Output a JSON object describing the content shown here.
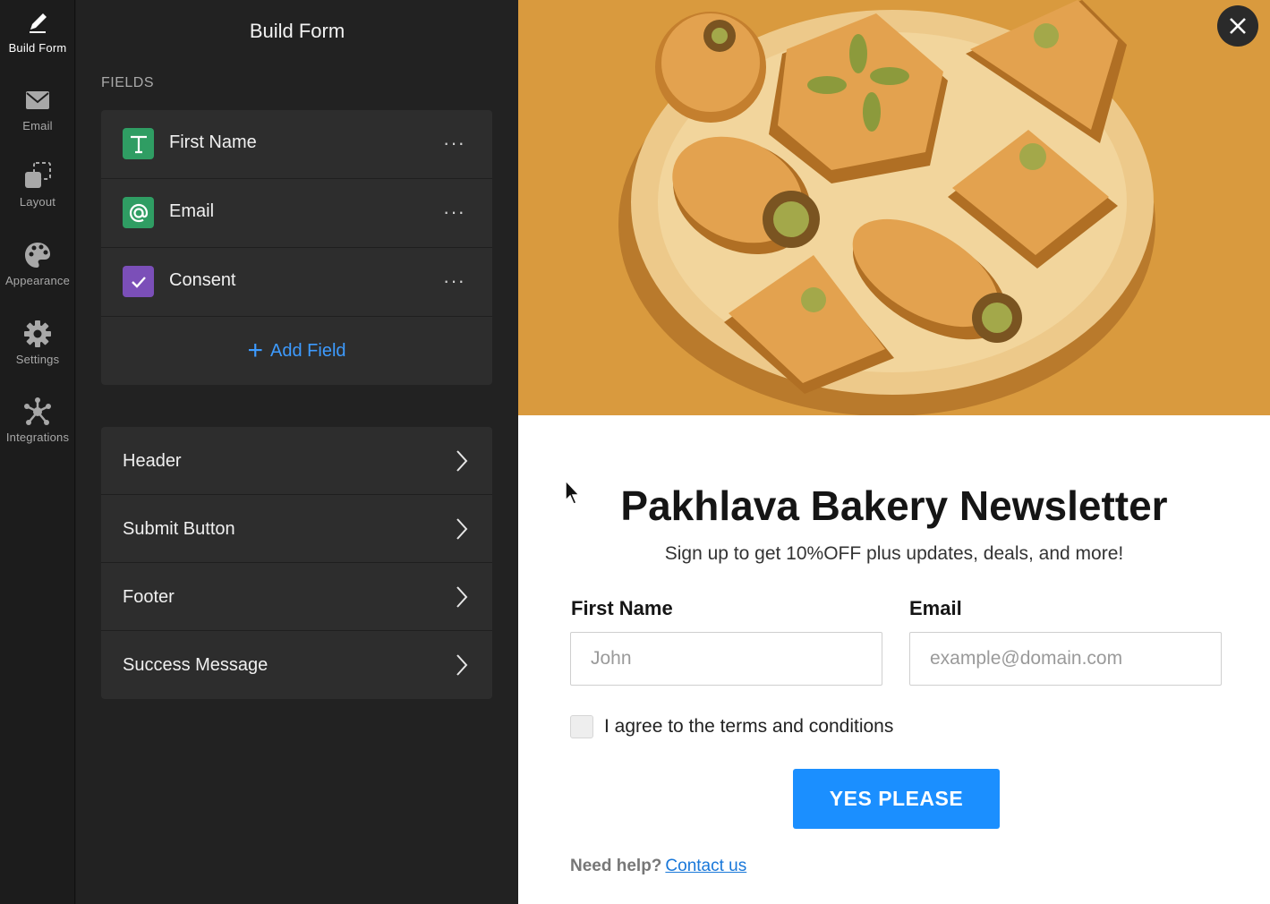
{
  "rail": {
    "items": [
      {
        "label": "Build Form",
        "icon": "pencil-icon"
      },
      {
        "label": "Email",
        "icon": "envelope-icon"
      },
      {
        "label": "Layout",
        "icon": "layout-icon"
      },
      {
        "label": "Appearance",
        "icon": "palette-icon"
      },
      {
        "label": "Settings",
        "icon": "gear-icon"
      },
      {
        "label": "Integrations",
        "icon": "integrations-icon"
      }
    ]
  },
  "panel": {
    "title": "Build Form",
    "fields_heading": "FIELDS",
    "fields": [
      {
        "name": "First Name",
        "icon": "text-field-icon",
        "color": "#2f9d63"
      },
      {
        "name": "Email",
        "icon": "at-sign-icon",
        "color": "#2f9d63"
      },
      {
        "name": "Consent",
        "icon": "checkbox-icon",
        "color": "#7b4fb8"
      }
    ],
    "more_glyph": "···",
    "add_field": "Add Field",
    "sections": [
      "Header",
      "Submit Button",
      "Footer",
      "Success Message"
    ]
  },
  "preview": {
    "title": "Pakhlava Bakery Newsletter",
    "subtitle": "Sign up to get 10%OFF plus updates, deals, and more!",
    "first_name_label": "First Name",
    "first_name_placeholder": "John",
    "email_label": "Email",
    "email_placeholder": "example@domain.com",
    "consent_text": "I agree to the terms and conditions",
    "submit_label": "YES PLEASE",
    "help_text": "Need help?",
    "help_link": "Contact us"
  },
  "colors": {
    "accent": "#1b8fff",
    "link": "#3d9bff",
    "hero_bg": "#d99a3e"
  }
}
